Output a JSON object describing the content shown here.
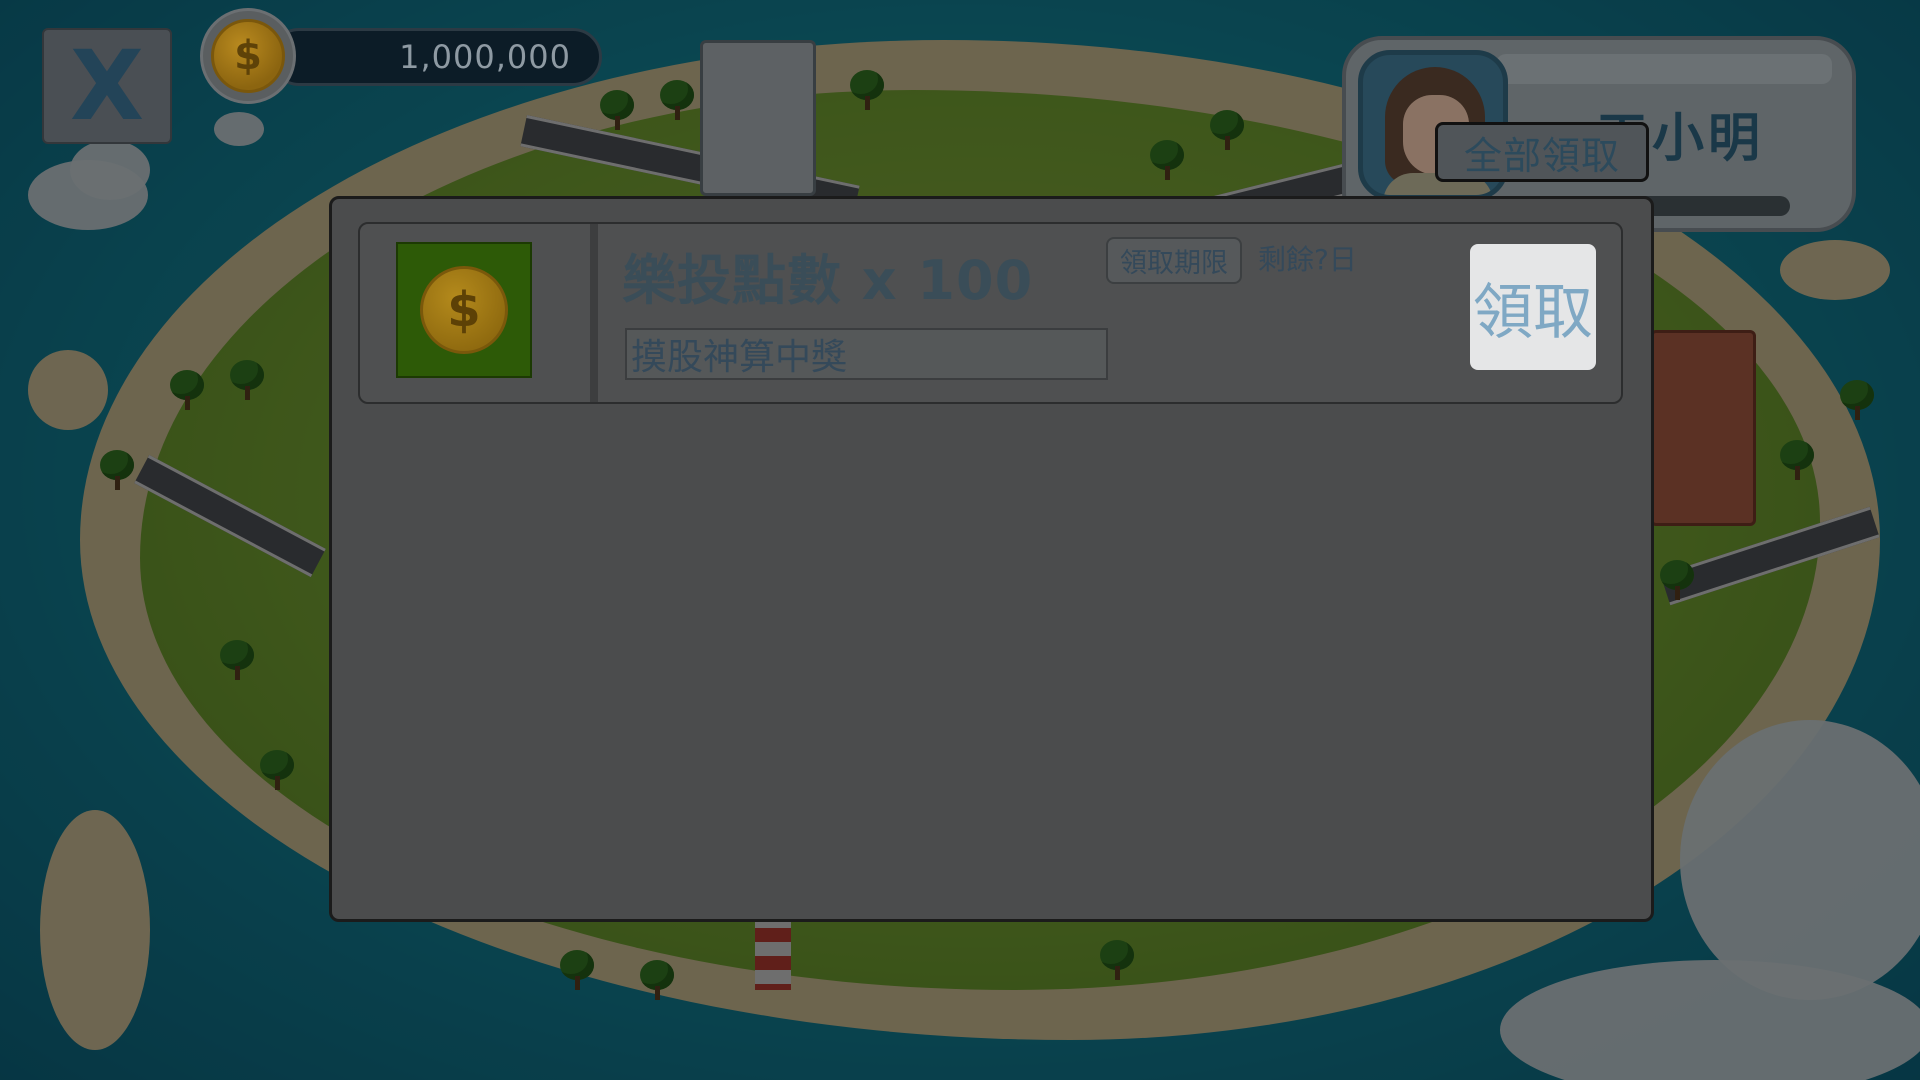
{
  "hud": {
    "close_label": "X",
    "coins": "1,000,000",
    "coin_symbol": "$"
  },
  "profile": {
    "player_name": "王小明",
    "claim_all_label": "全部領取"
  },
  "mailbox": {
    "items": [
      {
        "title": "樂投點數 x 100",
        "icon_symbol": "$",
        "deadline_label": "領取期限",
        "remaining": "剩餘?日",
        "source": "摸股神算中獎",
        "claim_label": "領取"
      }
    ]
  },
  "colors": {
    "overlay": "#000000",
    "modal_bg": "#4b4c4d",
    "claim_button_bg": "#e5e6e7",
    "claim_button_text": "#7fa8c4"
  }
}
